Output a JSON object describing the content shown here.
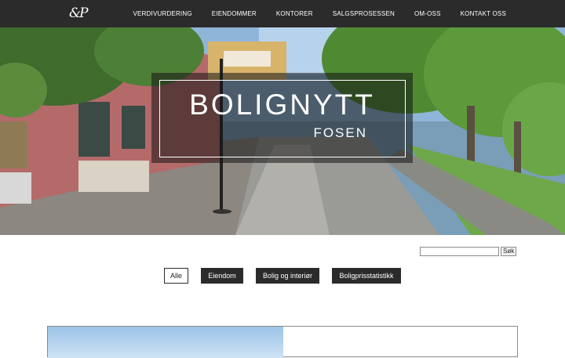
{
  "header": {
    "logo_text": "&P",
    "nav": [
      {
        "label": "VERDIVURDERING"
      },
      {
        "label": "EIENDOMMER"
      },
      {
        "label": "KONTORER"
      },
      {
        "label": "SALGSPROSESSEN"
      },
      {
        "label": "OM-OSS"
      },
      {
        "label": "KONTAKT OSS"
      }
    ]
  },
  "hero": {
    "title": "BOLIGNYTT",
    "subtitle": "FOSEN"
  },
  "search": {
    "value": "",
    "button_label": "Søk"
  },
  "filters": [
    {
      "label": "Alle",
      "active": true
    },
    {
      "label": "Eiendom",
      "active": false
    },
    {
      "label": "Bolig og interiør",
      "active": false
    },
    {
      "label": "Boligprisstatistikk",
      "active": false
    }
  ],
  "colors": {
    "header_bg": "#2b2b2b",
    "filter_dark": "#2b2b2b",
    "text_light": "#ffffff"
  }
}
